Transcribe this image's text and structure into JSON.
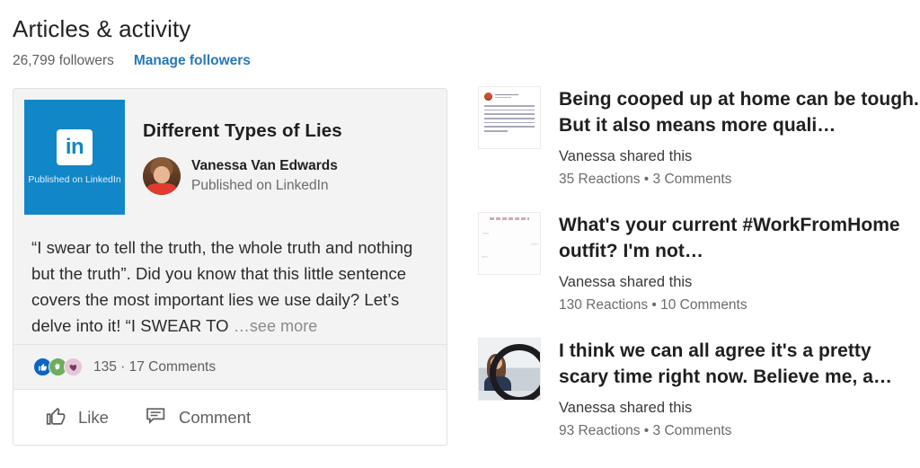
{
  "header": {
    "title": "Articles & activity",
    "followers": "26,799 followers",
    "manage_link": "Manage followers"
  },
  "article_card": {
    "thumbnail": {
      "logo_text": "in",
      "caption": "Published on LinkedIn",
      "background_color": "#1287c8"
    },
    "title": "Different Types of Lies",
    "author_name": "Vanessa Van Edwards",
    "author_subtitle": "Published on LinkedIn",
    "body": "“I swear to tell the truth, the whole truth and nothing but the truth”. Did you know that this little sentence covers the most important lies we use daily? Let’s delve into it! “I SWEAR TO",
    "see_more": "…see more",
    "reactions": [
      {
        "name": "like",
        "glyph": "👍",
        "color": "#0a66c2"
      },
      {
        "name": "celebrate",
        "glyph": "👏",
        "color": "#6cae5e"
      },
      {
        "name": "support",
        "glyph": "🫶",
        "color": "#e8c4d8"
      }
    ],
    "counts_text": "135 · 17 Comments",
    "actions": {
      "like_label": "Like",
      "comment_label": "Comment"
    }
  },
  "activity": [
    {
      "title": "Being cooped up at home can be tough. But it also means more quali…",
      "shared_by": "Vanessa shared this",
      "stats": "35 Reactions • 3 Comments",
      "thumbnail_kind": "text-post-screenshot"
    },
    {
      "title": "What's your current #WorkFromHome outfit? I'm not…",
      "shared_by": "Vanessa shared this",
      "stats": "130 Reactions • 10 Comments",
      "thumbnail_kind": "outfit-illustration"
    },
    {
      "title": "I think we can all agree it's a pretty scary time right now. Believe me, a…",
      "shared_by": "Vanessa shared this",
      "stats": "93 Reactions • 3 Comments",
      "thumbnail_kind": "ring-light-photo"
    }
  ],
  "colors": {
    "link_blue": "#2877b8",
    "linkedin_blue": "#1287c8",
    "card_background": "#f3f3f3"
  }
}
